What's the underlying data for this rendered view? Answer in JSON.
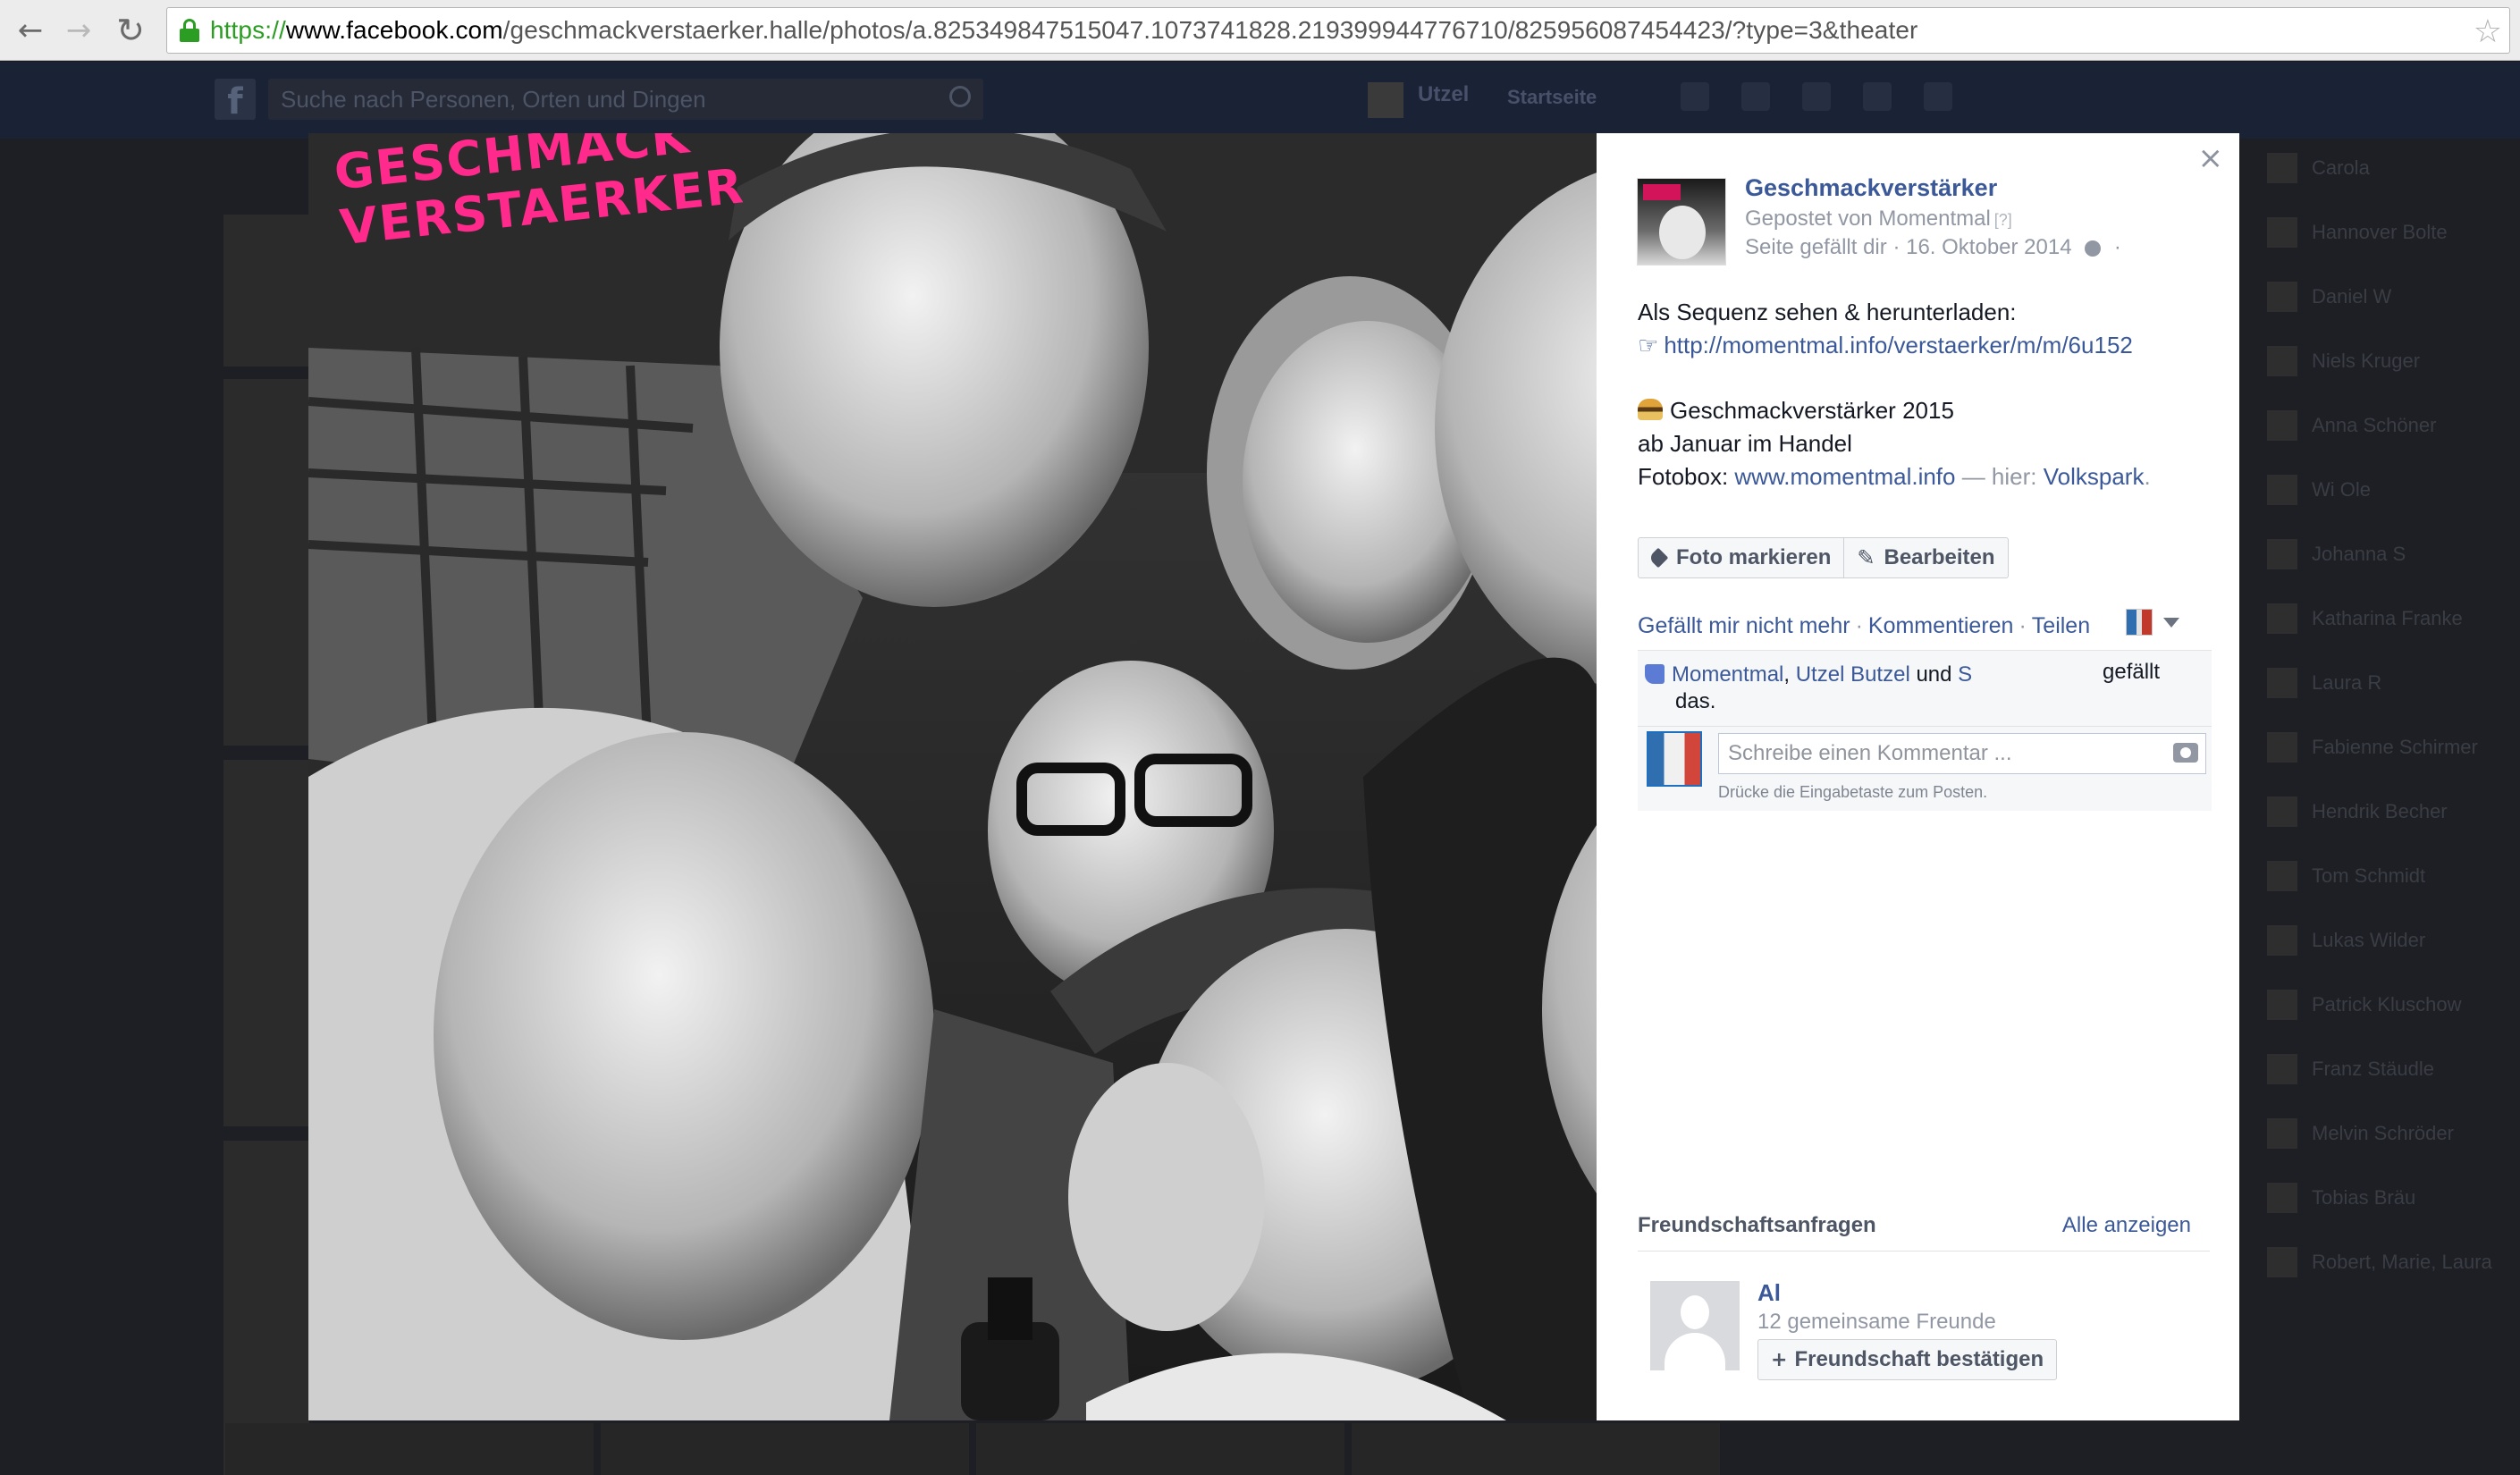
{
  "browser": {
    "url_scheme": "https://",
    "url_host": "www.facebook.com",
    "url_path": "/geschmackverstaerker.halle/photos/a.825349847515047.1073741828.219399944776710/825956087454423/?type=3&theater",
    "icons": {
      "back": "arrow-left-icon",
      "forward": "arrow-right-icon",
      "reload": "reload-icon",
      "lock": "lock-icon",
      "bookmark": "star-icon"
    }
  },
  "fb_header": {
    "logo": "f",
    "search_placeholder": "Suche nach Personen, Orten und Dingen",
    "user_name": "Utzel",
    "home_label": "Startseite"
  },
  "sidebar_contacts": [
    "Carola",
    "Hannover Bolte",
    "Daniel W",
    "Niels Kruger",
    "Anna Schöner",
    "Wi Ole",
    "Johanna S",
    "Katharina Franke",
    "Laura R",
    "Fabienne Schirmer",
    "Hendrik Becher",
    "Tom Schmidt",
    "Lukas Wilder",
    "Patrick Kluschow",
    "Franz Stäudle",
    "Melvin Schröder",
    "Tobias Bräu",
    "Robert, Marie, Laura"
  ],
  "photo": {
    "overlay_line1": "GESCHMACK",
    "overlay_line2": "VERSTAERKER",
    "overlay_color": "#ff2a8c"
  },
  "post": {
    "page_name": "Geschmackverstärker",
    "posted_by": "Gepostet von Momentmal",
    "posted_by_help": "[?]",
    "meta_liked": "Seite gefällt dir",
    "meta_date": "16. Oktober 2014",
    "meta_sep": "·",
    "line1": "Als Sequenz sehen & herunterladen:",
    "link1": "http://momentmal.info/verstaerker/m/m/6u152",
    "line3": "Geschmackverstärker 2015",
    "line4": "ab Januar im Handel",
    "line5_prefix": "Fotobox: ",
    "line5_link": "www.momentmal.info",
    "line5_sep": " — hier: ",
    "line5_place": "Volkspark",
    "line5_end": "."
  },
  "buttons": {
    "tag_photo": "Foto markieren",
    "edit": "Bearbeiten"
  },
  "actions": {
    "unlike": "Gefällt mir nicht mehr",
    "comment": "Kommentieren",
    "share": "Teilen",
    "sep": "·"
  },
  "likes": {
    "name1": "Momentmal",
    "name2": "Utzel Butzel",
    "and": "und",
    "name3": "S",
    "suffix1": "gefällt",
    "suffix2": "das."
  },
  "comment": {
    "placeholder": "Schreibe einen Kommentar ...",
    "hint": "Drücke die Eingabetaste zum Posten."
  },
  "friend_requests": {
    "heading": "Freundschaftsanfragen",
    "see_all": "Alle anzeigen",
    "name": "Al",
    "mutual": "12 gemeinsame Freunde",
    "confirm": "Freundschaft bestätigen"
  },
  "colors": {
    "link": "#3b5998",
    "muted": "#9197a3",
    "secure_green": "#2a9d22",
    "overlay_bg": "#1d1f25"
  }
}
